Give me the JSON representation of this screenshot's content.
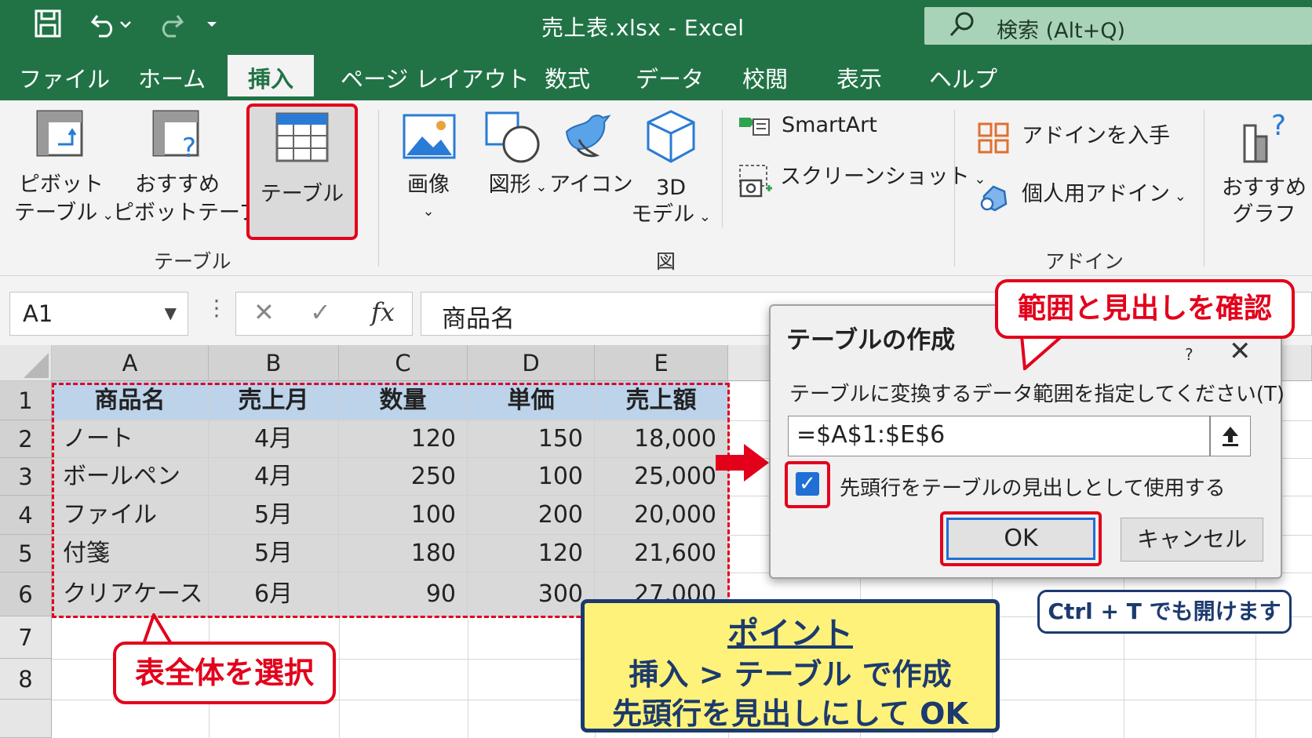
{
  "titlebar": {
    "title": "売上表.xlsx  -  Excel",
    "search_placeholder": "検索 (Alt+Q)"
  },
  "menu": {
    "tabs": [
      "ファイル",
      "ホーム",
      "挿入",
      "ページ レイアウト",
      "数式",
      "データ",
      "校閲",
      "表示",
      "ヘルプ"
    ],
    "active": "挿入"
  },
  "ribbon": {
    "pivot_line1": "ピボット",
    "pivot_line2": "テーブル",
    "recpivot_line1": "おすすめ",
    "recpivot_line2": "ピボットテーブル",
    "table_label": "テーブル",
    "group_table": "テーブル",
    "picture_label": "画像",
    "shapes_label": "図形",
    "icons_label": "アイコン",
    "model3d_line1": "3D",
    "model3d_line2": "モデル",
    "group_illust": "図",
    "smartart_label": "SmartArt",
    "screenshot_label": "スクリーンショット",
    "getaddins_label": "アドインを入手",
    "myaddins_label": "個人用アドイン",
    "group_addins": "アドイン",
    "recchart_line1": "おすすめ",
    "recchart_line2": "グラフ"
  },
  "formulabar": {
    "namebox": "A1",
    "fx": "fx",
    "content": "商品名"
  },
  "grid": {
    "columns": [
      "A",
      "B",
      "C",
      "D",
      "E"
    ],
    "rows": [
      "1",
      "2",
      "3",
      "4",
      "5",
      "6",
      "7",
      "8"
    ],
    "header": [
      "商品名",
      "売上月",
      "数量",
      "単価",
      "売上額"
    ],
    "data": [
      [
        "ノート",
        "4月",
        "120",
        "150",
        "18,000"
      ],
      [
        "ボールペン",
        "4月",
        "250",
        "100",
        "25,000"
      ],
      [
        "ファイル",
        "5月",
        "100",
        "200",
        "20,000"
      ],
      [
        "付箋",
        "5月",
        "180",
        "120",
        "21,600"
      ],
      [
        "クリアケース",
        "6月",
        "90",
        "300",
        "27,000"
      ]
    ]
  },
  "dialog": {
    "title": "テーブルの作成",
    "help": "?",
    "close": "✕",
    "prompt": "テーブルに変換するデータ範囲を指定してください(T)",
    "range": "=$A$1:$E$6",
    "checkbox_label": "先頭行をテーブルの見出しとして使用する",
    "checkbox_checked": true,
    "ok": "OK",
    "cancel": "キャンセル"
  },
  "callouts": {
    "range_check": "範囲と見出しを確認",
    "select_all": "表全体を選択",
    "shortcut": "Ctrl + T でも開けます",
    "point_title": "ポイント",
    "point_line1": "挿入 > テーブル で作成",
    "point_line2": "先頭行を見出しにして OK"
  },
  "colors": {
    "excel_green": "#217346",
    "highlight_red": "#e3001b",
    "header_blue": "#bcd3ea",
    "point_yellow": "#fff27a",
    "navy": "#1c3a6e"
  }
}
